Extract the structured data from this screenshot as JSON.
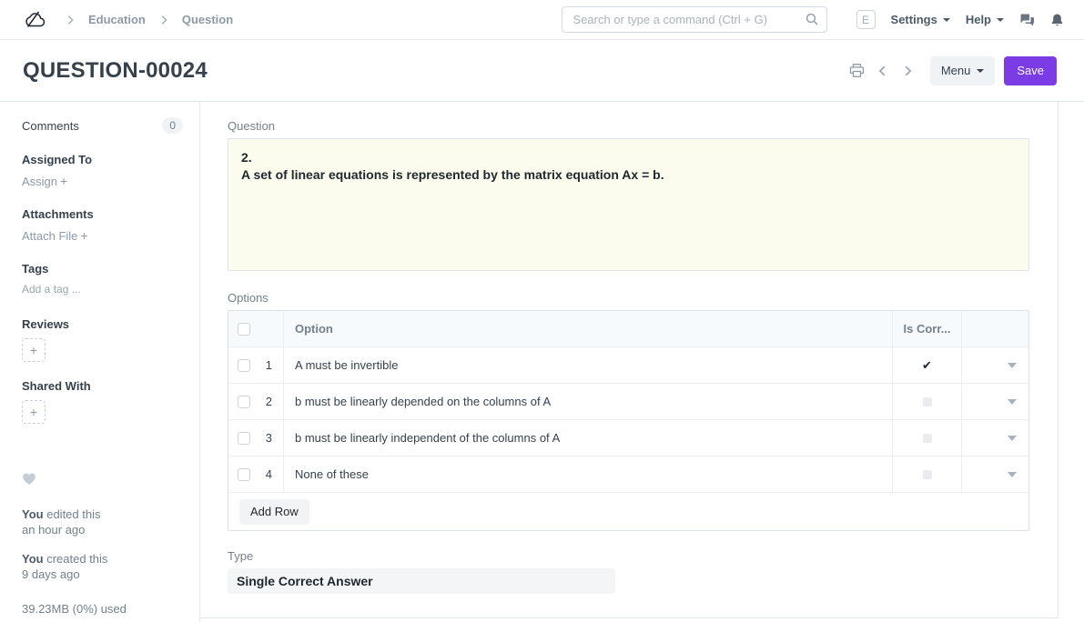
{
  "navbar": {
    "breadcrumbs": [
      {
        "label": "Education"
      },
      {
        "label": "Question"
      }
    ],
    "search": {
      "placeholder": "Search or type a command (Ctrl + G)"
    },
    "avatar_letter": "E",
    "settings_label": "Settings",
    "help_label": "Help"
  },
  "header": {
    "title": "QUESTION-00024",
    "menu_label": "Menu",
    "save_label": "Save"
  },
  "sidebar": {
    "comments": {
      "label": "Comments",
      "count": "0"
    },
    "assigned_to": {
      "label": "Assigned To",
      "action": "Assign",
      "plus": "+"
    },
    "attachments": {
      "label": "Attachments",
      "action": "Attach File",
      "plus": "+"
    },
    "tags": {
      "label": "Tags",
      "placeholder": "Add a tag ..."
    },
    "reviews": {
      "label": "Reviews",
      "plus": "+"
    },
    "shared_with": {
      "label": "Shared With",
      "plus": "+"
    },
    "activity": [
      {
        "actor": "You",
        "action": "edited this",
        "when": "an hour ago"
      },
      {
        "actor": "You",
        "action": "created this",
        "when": "9 days ago"
      }
    ],
    "storage": "39.23MB (0%) used"
  },
  "form": {
    "question": {
      "label": "Question",
      "lines": [
        "2.",
        "A set of linear equations is represented by the matrix equation Ax = b."
      ]
    },
    "options": {
      "label": "Options",
      "columns": {
        "option": "Option",
        "is_correct": "Is Corr..."
      },
      "rows": [
        {
          "idx": "1",
          "option": "A must be invertible",
          "is_correct": true
        },
        {
          "idx": "2",
          "option": "b must be linearly depended on the columns of A",
          "is_correct": false
        },
        {
          "idx": "3",
          "option": "b must be linearly independent of the columns of A",
          "is_correct": false
        },
        {
          "idx": "4",
          "option": "None of these",
          "is_correct": false
        }
      ],
      "add_row_label": "Add Row"
    },
    "type": {
      "label": "Type",
      "value": "Single Correct Answer"
    }
  },
  "colors": {
    "primary": "#7b3be5",
    "question_highlight_bg": "#fcfcee",
    "table_header_bg": "#f7fafc"
  }
}
